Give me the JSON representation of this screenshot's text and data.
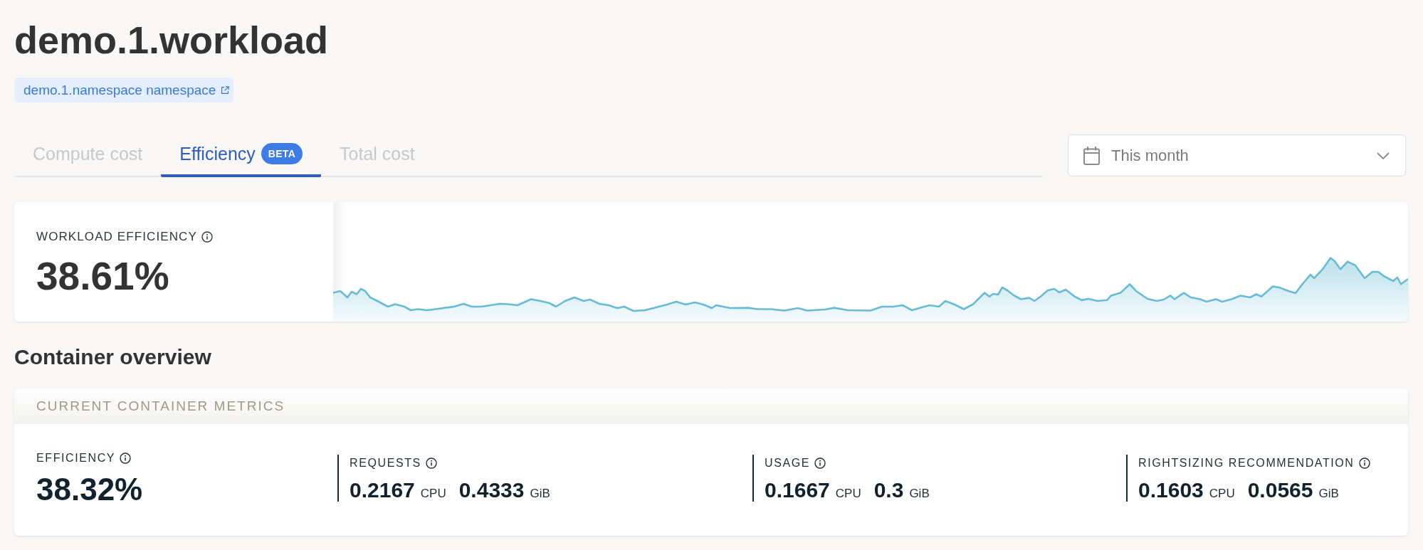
{
  "page": {
    "title": "demo.1.workload",
    "namespace_link": "demo.1.namespace namespace"
  },
  "tabs": [
    {
      "label": "Compute cost",
      "selected": false
    },
    {
      "label": "Efficiency",
      "badge": "BETA",
      "selected": true
    },
    {
      "label": "Total cost",
      "selected": false
    }
  ],
  "date_range": {
    "value": "This month"
  },
  "workload_efficiency": {
    "label": "WORKLOAD EFFICIENCY",
    "value": "38.61%"
  },
  "container_overview": {
    "title": "Container overview",
    "panel_title": "CURRENT CONTAINER METRICS",
    "metrics": [
      {
        "kind": "percent",
        "label": "EFFICIENCY",
        "value": "38.32%"
      },
      {
        "kind": "resources",
        "label": "REQUESTS",
        "values": [
          {
            "amount": "0.2167",
            "unit": "CPU"
          },
          {
            "amount": "0.4333",
            "unit": "GiB"
          }
        ]
      },
      {
        "kind": "resources",
        "label": "USAGE",
        "values": [
          {
            "amount": "0.1667",
            "unit": "CPU"
          },
          {
            "amount": "0.3",
            "unit": "GiB"
          }
        ]
      },
      {
        "kind": "resources",
        "label": "RIGHTSIZING RECOMMENDATION",
        "values": [
          {
            "amount": "0.1603",
            "unit": "CPU"
          },
          {
            "amount": "0.0565",
            "unit": "GiB"
          }
        ]
      }
    ]
  }
}
